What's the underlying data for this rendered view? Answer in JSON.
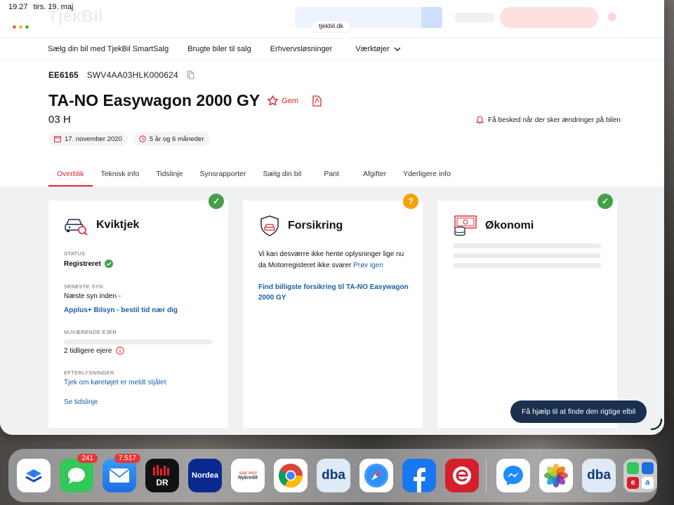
{
  "status_bar": {
    "time": "19.27",
    "date": "tirs. 19. maj"
  },
  "browser": {
    "url": "tjekbil.dk"
  },
  "nav": {
    "items": [
      "Sælg din bil med TjekBil SmartSalg",
      "Brugte biler til salg",
      "Erhvervsløsninger",
      "Værktøjer"
    ]
  },
  "vehicle": {
    "plate": "EE6165",
    "vin": "SWV4AA03HLK000624",
    "title": "TA-NO Easywagon 2000 GY",
    "subtitle": "03 H",
    "save_label": "Gem",
    "notify_label": "Få besked når der sker ændringer på bilen",
    "chips": [
      "17. november 2020",
      "5 år og 6 måneder"
    ]
  },
  "tabs": [
    "Overblik",
    "Teknisk info",
    "Tidslinje",
    "Synsrapporter",
    "Sælg din bil",
    "Pant",
    "Afgifter",
    "Yderligere info"
  ],
  "cards": {
    "kviktjek": {
      "title": "Kviktjek",
      "status_label": "STATUS",
      "status_value": "Registreret",
      "inspection_label": "SENESTE SYN",
      "inspection_value": "Næste syn inden -",
      "inspection_link": "Applus+ Bilsyn - bestil tid nær dig",
      "owner_label": "NUVÆRENDE EJER",
      "owner_value": "2 tidligere ejere",
      "wanted_label": "EFTERLYSNINGER",
      "wanted_link": "Tjek om køretøjet er meldt stjålet",
      "timeline_link": "Se tidslinje"
    },
    "forsikring": {
      "title": "Forsikring",
      "message": "Vi kan desværre ikke hente oplysninger lige nu da Motorregisteret ikke svarer",
      "retry_link": "Prøv igen",
      "cta_link": "Find billigste forsikring til TA-NO Easywagon 2000 GY",
      "badge": "?"
    },
    "okonomi": {
      "title": "Økonomi"
    }
  },
  "help_button": "Få hjælp til at finde den rigtige elbil",
  "dock": {
    "messages_badge": "241",
    "mail_badge": "7.517",
    "dr_label": "DR",
    "nordea_label": "Nordea",
    "nykredit_label": "Nykredit",
    "nykredit_top": "spar nord",
    "dba_label": "dba",
    "dba2_label": "dba"
  },
  "colors": {
    "brand_red": "#e0242b",
    "link_blue": "#1b5fa8",
    "ok_green": "#43a047",
    "warn_orange": "#f5a300",
    "help_navy": "#19304f"
  }
}
